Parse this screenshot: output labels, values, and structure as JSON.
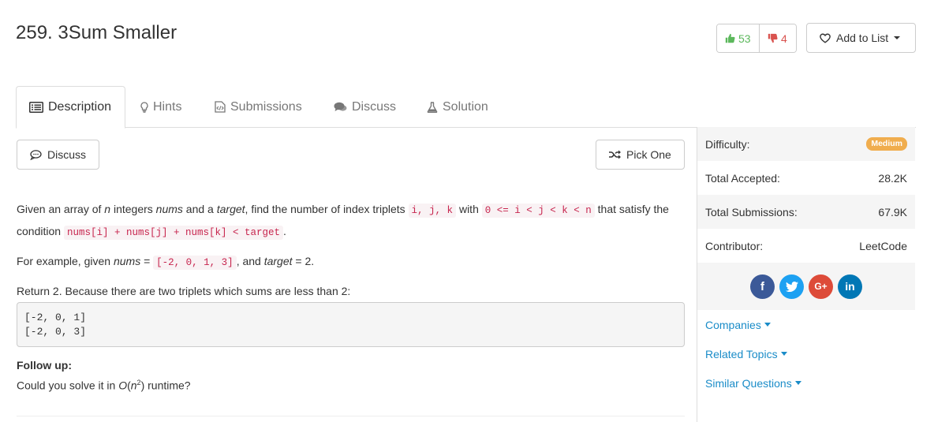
{
  "problem": {
    "title": "259. 3Sum Smaller",
    "likes": "53",
    "dislikes": "4",
    "add_to_list": "Add to List"
  },
  "tabs": [
    {
      "label": "Description",
      "icon": "list-icon"
    },
    {
      "label": "Hints",
      "icon": "lightbulb-icon"
    },
    {
      "label": "Submissions",
      "icon": "code-file-icon"
    },
    {
      "label": "Discuss",
      "icon": "comments-icon"
    },
    {
      "label": "Solution",
      "icon": "flask-icon"
    }
  ],
  "buttons": {
    "discuss": "Discuss",
    "pick_one": "Pick One"
  },
  "description": {
    "p1_a": "Given an array of ",
    "p1_n": "n",
    "p1_b": " integers ",
    "p1_nums": "nums",
    "p1_c": " and a ",
    "p1_target": "target",
    "p1_d": ", find the number of index triplets ",
    "p1_code1": "i, j, k",
    "p1_e": " with ",
    "p1_code2": "0 <= i < j < k < n",
    "p1_f": " that satisfy the condition ",
    "p1_code3": "nums[i] + nums[j] + nums[k] < target",
    "p1_g": ".",
    "p2_a": "For example, given ",
    "p2_nums": "nums",
    "p2_b": " = ",
    "p2_code": "[-2, 0, 1, 3]",
    "p2_c": ", and ",
    "p2_target": "target",
    "p2_d": " = 2.",
    "p3": "Return 2. Because there are two triplets which sums are less than 2:",
    "example": "[-2, 0, 1]\n[-2, 0, 3]",
    "follow_up_label": "Follow up:",
    "follow_up_a": "Could you solve it in ",
    "follow_up_O": "O",
    "follow_up_b": "(",
    "follow_up_n": "n",
    "follow_up_exp": "2",
    "follow_up_c": ") runtime?"
  },
  "sidebar": {
    "difficulty_label": "Difficulty:",
    "difficulty_value": "Medium",
    "accepted_label": "Total Accepted:",
    "accepted_value": "28.2K",
    "submissions_label": "Total Submissions:",
    "submissions_value": "67.9K",
    "contributor_label": "Contributor:",
    "contributor_value": "LeetCode",
    "companies": "Companies",
    "related_topics": "Related Topics",
    "similar_questions": "Similar Questions"
  },
  "colors": {
    "like": "#5cb85c",
    "dislike": "#d9534f",
    "medium_badge": "#f0ad4e",
    "link": "#1a8cc8",
    "facebook": "#3b5998",
    "twitter": "#1da1f2",
    "googleplus": "#dd4b39",
    "linkedin": "#0077b5"
  }
}
